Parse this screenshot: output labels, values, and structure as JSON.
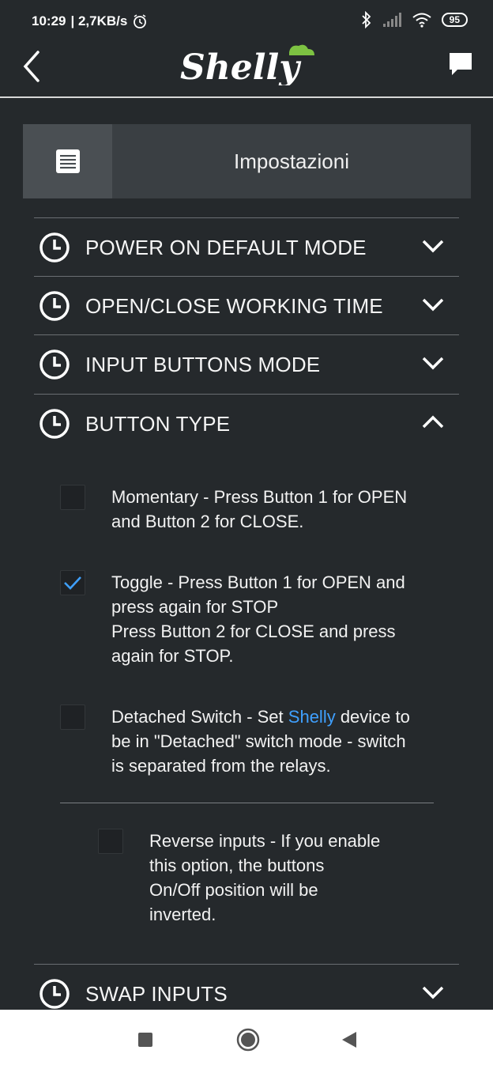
{
  "status_bar": {
    "time": "10:29",
    "speed": "| 2,7KB/s",
    "battery": "95"
  },
  "app_bar": {
    "logo_text": "Shelly",
    "colors": {
      "accent_green": "#7dc242",
      "link_blue": "#3fa0ff"
    }
  },
  "settings": {
    "title": "Impostazioni"
  },
  "sections": [
    {
      "label": "POWER ON DEFAULT MODE",
      "expanded": false
    },
    {
      "label": "OPEN/CLOSE WORKING TIME",
      "expanded": false
    },
    {
      "label": "INPUT BUTTONS MODE",
      "expanded": false
    },
    {
      "label": "BUTTON TYPE",
      "expanded": true
    },
    {
      "label": "SWAP INPUTS",
      "expanded": false
    }
  ],
  "button_type": {
    "momentary": {
      "text": "Momentary - Press Button 1 for OPEN\nand Button 2 for CLOSE.",
      "checked": false
    },
    "toggle": {
      "text": "Toggle - Press Button 1 for OPEN and\npress again for STOP\nPress Button 2 for CLOSE and press\nagain for STOP.",
      "checked": true
    },
    "detached": {
      "text_before": "Detached Switch - Set ",
      "brand": "Shelly",
      "text_after": " device to\nbe in \"Detached\" switch mode - switch\nis separated from the relays.",
      "checked": false
    },
    "reverse": {
      "text": "Reverse inputs - If you enable\nthis option, the buttons\nOn/Off position will be\ninverted.",
      "checked": false
    }
  },
  "icons": {
    "back": "back-arrow-icon",
    "chat": "chat-bubble-icon",
    "settings": "document-lines-icon",
    "section": "clock-icon",
    "collapsed": "chevron-down-icon",
    "expanded": "chevron-up-icon",
    "nav_recent": "square-icon",
    "nav_home": "circle-icon",
    "nav_back": "triangle-back-icon"
  }
}
